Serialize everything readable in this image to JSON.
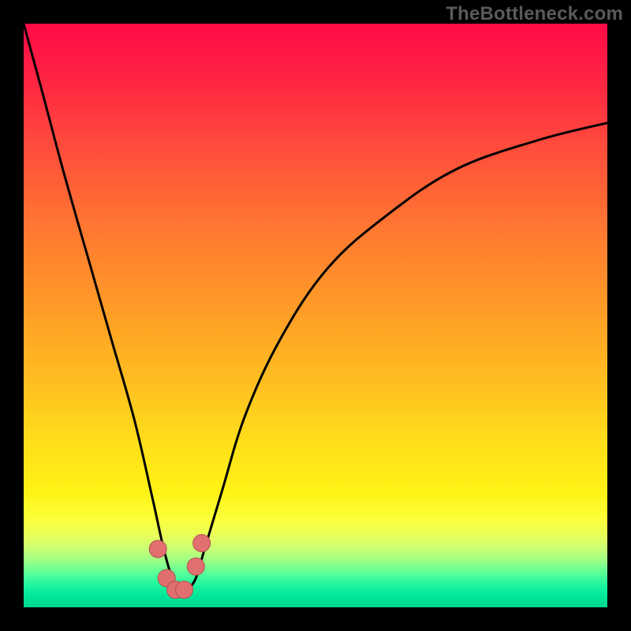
{
  "watermark": "TheBottleneck.com",
  "colors": {
    "background": "#000000",
    "curve_stroke": "#000000",
    "marker_fill": "#e26f6f",
    "marker_stroke": "#b05252"
  },
  "chart_data": {
    "type": "line",
    "title": "",
    "xlabel": "",
    "ylabel": "",
    "xlim": [
      0,
      100
    ],
    "ylim": [
      0,
      100
    ],
    "grid": false,
    "legend": false,
    "note": "Axes are unlabeled; values are % of the plot area (0,0 = bottom-left). Curve is a valley shape; bottleneck optimum sits near x≈26%.",
    "series": [
      {
        "name": "bottleneck-curve",
        "x": [
          0,
          3,
          7,
          11,
          15,
          19,
          22,
          24,
          25.5,
          27,
          28,
          29.5,
          31,
          34,
          38,
          44,
          52,
          62,
          74,
          88,
          100
        ],
        "y": [
          100,
          89,
          74,
          60,
          46,
          32,
          19,
          10,
          5,
          3,
          3,
          5,
          10,
          20,
          33,
          46,
          58,
          67,
          75,
          80,
          83
        ]
      }
    ],
    "markers": [
      {
        "x": 23.0,
        "y": 10.0
      },
      {
        "x": 24.5,
        "y": 5.0
      },
      {
        "x": 26.0,
        "y": 3.0
      },
      {
        "x": 27.5,
        "y": 3.0
      },
      {
        "x": 29.5,
        "y": 7.0
      },
      {
        "x": 30.5,
        "y": 11.0
      }
    ]
  }
}
